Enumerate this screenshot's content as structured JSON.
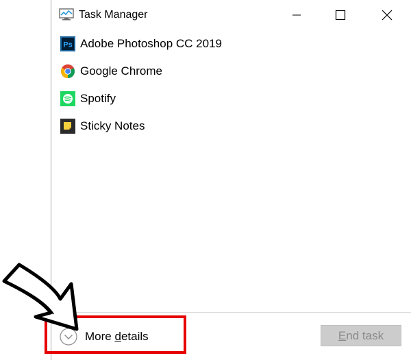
{
  "window": {
    "title": "Task Manager",
    "title_icon": "task-manager-icon",
    "controls": {
      "minimize": "minimize-icon",
      "maximize": "maximize-icon",
      "close": "close-icon"
    }
  },
  "processes": [
    {
      "label": "Adobe Photoshop CC 2019",
      "icon": "photoshop-icon",
      "icon_color": "#001d34",
      "accent": "#31a8ff"
    },
    {
      "label": "Google Chrome",
      "icon": "chrome-icon"
    },
    {
      "label": "Spotify",
      "icon": "spotify-icon",
      "icon_color": "#1ed760"
    },
    {
      "label": "Sticky Notes",
      "icon": "sticky-notes-icon",
      "icon_color": "#2b2b2b",
      "accent": "#f7d13d"
    }
  ],
  "footer": {
    "more_details_prefix": "More ",
    "more_details_underlined": "d",
    "more_details_suffix": "etails",
    "end_task_underlined": "E",
    "end_task_suffix": "nd task"
  },
  "annotation": {
    "highlight_color": "#e60000",
    "arrow": "pointer-arrow-icon"
  }
}
